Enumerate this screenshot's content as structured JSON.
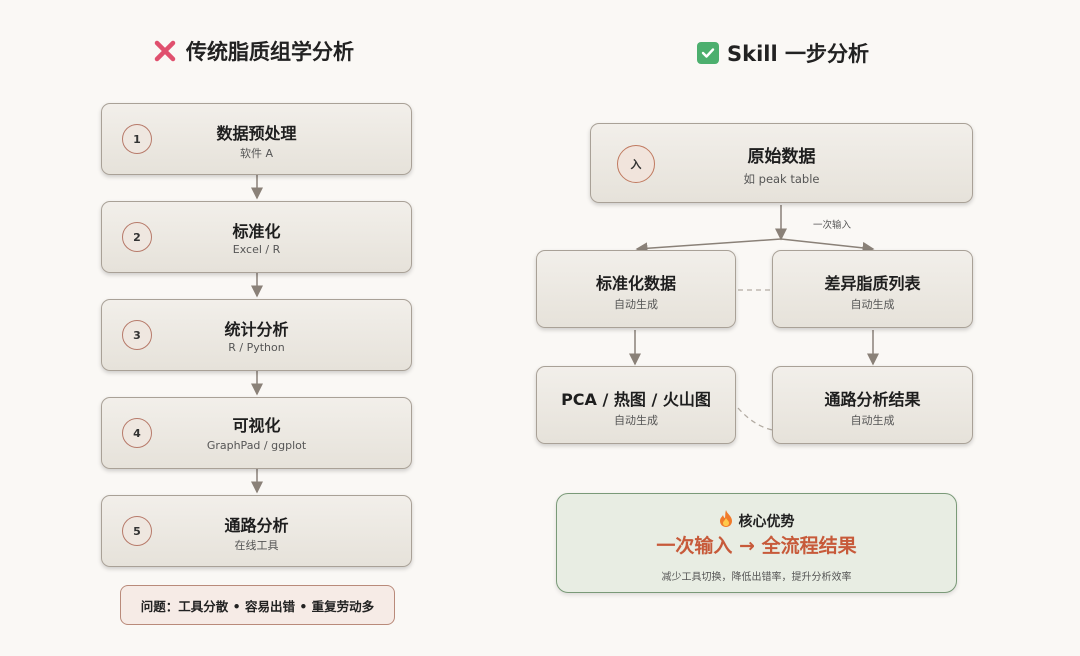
{
  "left": {
    "heading": "传统脂质组学分析",
    "steps": [
      {
        "num": "1",
        "title": "数据预处理",
        "sub": "软件 A"
      },
      {
        "num": "2",
        "title": "标准化",
        "sub": "Excel / R"
      },
      {
        "num": "3",
        "title": "统计分析",
        "sub": "R / Python"
      },
      {
        "num": "4",
        "title": "可视化",
        "sub": "GraphPad / ggplot"
      },
      {
        "num": "5",
        "title": "通路分析",
        "sub": "在线工具"
      }
    ],
    "problem": "问题：工具分散 • 容易出错 • 重复劳动多"
  },
  "right": {
    "heading": "Skill 一步分析",
    "input": {
      "badge": "入",
      "title": "原始数据",
      "sub": "如 peak table"
    },
    "once_label": "一次输入",
    "outputs": [
      {
        "title": "标准化数据",
        "sub": "自动生成"
      },
      {
        "title": "差异脂质列表",
        "sub": "自动生成"
      },
      {
        "title": "PCA / 热图 / 火山图",
        "sub": "自动生成"
      },
      {
        "title": "通路分析结果",
        "sub": "自动生成"
      }
    ],
    "summary": {
      "head": "核心优势",
      "main": "一次输入 → 全流程结果",
      "desc": "减少工具切换，降低出错率，提升分析效率"
    }
  },
  "colors": {
    "cross": "#e0506e",
    "check": "#4caf6e",
    "accent": "#c75a3a",
    "arrow": "#8a8178"
  }
}
